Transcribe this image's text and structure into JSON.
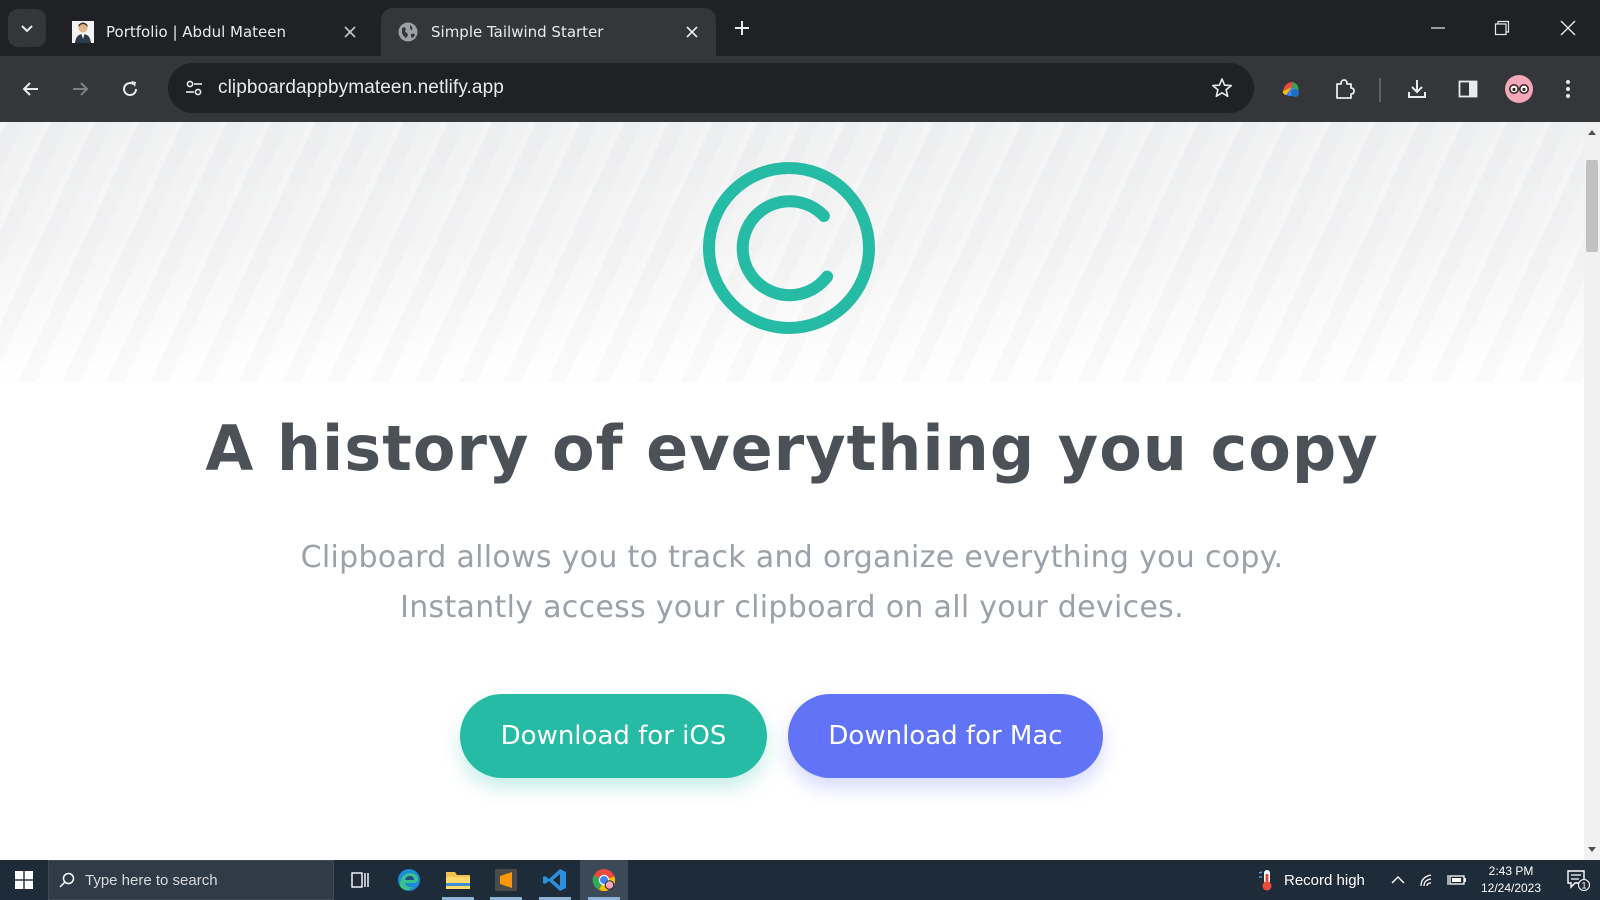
{
  "browser": {
    "tabs": [
      {
        "title": "Portfolio | Abdul Mateen",
        "favicon": "portfolio-avatar-icon",
        "active": false
      },
      {
        "title": "Simple Tailwind Starter",
        "favicon": "globe-icon",
        "active": true
      }
    ],
    "url": "clipboardappbymateen.netlify.app"
  },
  "page": {
    "headline": "A history of everything you copy",
    "subline_1": "Clipboard allows you to track and organize everything you copy.",
    "subline_2": "Instantly access your clipboard on all your devices.",
    "cta_ios": "Download for iOS",
    "cta_mac": "Download for Mac",
    "colors": {
      "accent_teal": "#26bba5",
      "accent_blue": "#6174f7",
      "headline": "#4c5158",
      "subtext": "#9aa1a9"
    }
  },
  "taskbar": {
    "search_placeholder": "Type here to search",
    "apps": [
      "task-view-icon",
      "edge-icon",
      "file-explorer-icon",
      "sublime-text-icon",
      "vscode-icon",
      "chrome-icon"
    ],
    "weather": "Record high",
    "time": "2:43 PM",
    "date": "12/24/2023",
    "notification_count": "1"
  }
}
